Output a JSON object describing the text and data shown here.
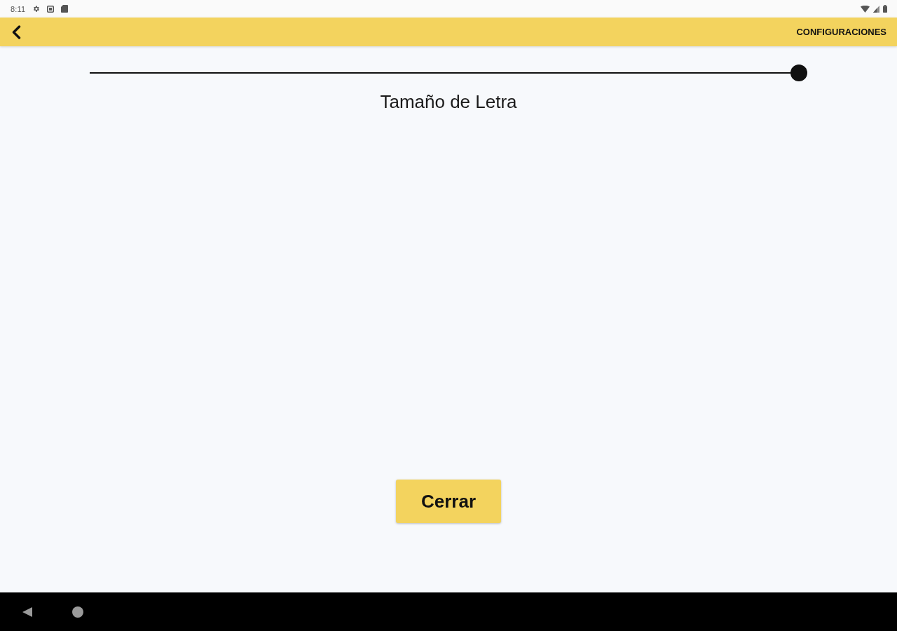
{
  "status_bar": {
    "time": "8:11"
  },
  "app_bar": {
    "title": "CONFIGURACIONES"
  },
  "font_size_slider": {
    "level": 1,
    "label": "Tamaño de Letra"
  },
  "close_button": {
    "label": "Cerrar"
  }
}
